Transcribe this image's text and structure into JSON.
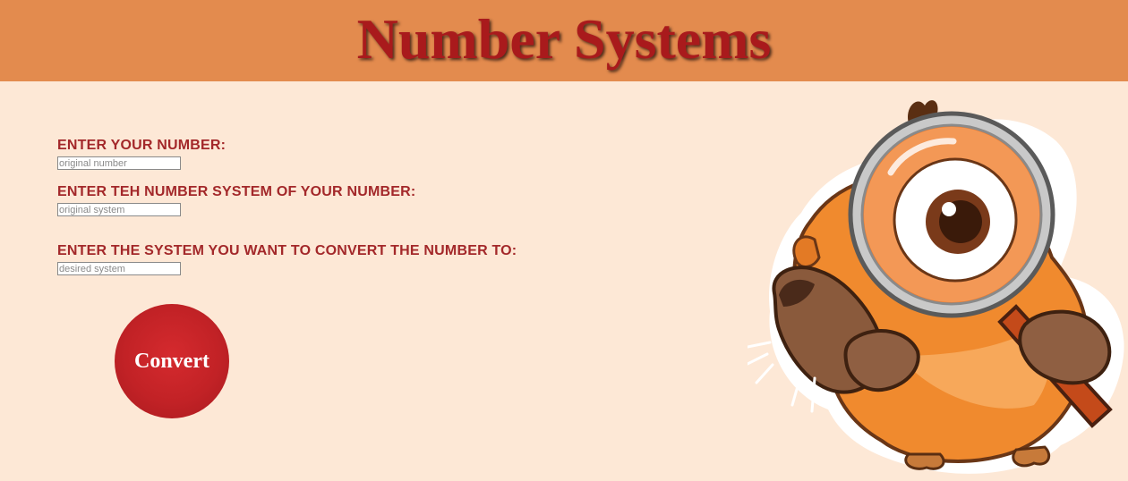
{
  "header": {
    "title": "Number Systems"
  },
  "form": {
    "number_label": "ENTER YOUR NUMBER:",
    "number_placeholder": "original number",
    "system_label": "ENTER TEH NUMBER SYSTEM OF YOUR NUMBER:",
    "system_placeholder": "original system",
    "target_label": "ENTER THE SYSTEM YOU WANT TO CONVERT THE NUMBER TO:",
    "target_placeholder": "desired system",
    "convert_label": "Convert"
  },
  "mascot": {
    "icon": "hamster-magnifying-glass-icon"
  },
  "colors": {
    "header_bg": "#e38b4e",
    "page_bg": "#fde8d6",
    "title": "#a91a1c",
    "label": "#a3282a",
    "button": "#c22226"
  }
}
